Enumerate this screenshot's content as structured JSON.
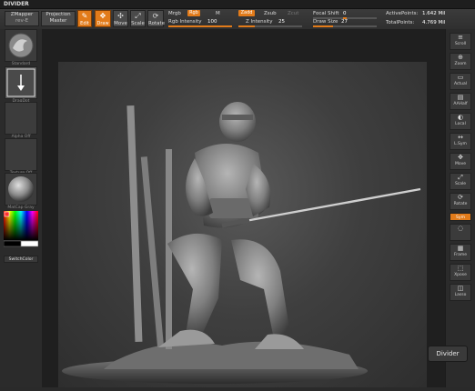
{
  "window": {
    "title": "DIVIDER"
  },
  "topbar": {
    "zmapper_label": "ZMapper",
    "zmapper_sub": "rev-E",
    "projection_label": "Projection",
    "projection_sub": "Master",
    "edit_label": "Edit",
    "draw_label": "Draw",
    "move_label": "Move",
    "scale_label": "Scale",
    "rotate_label": "Rotate",
    "mrgb_label": "Mrgb",
    "rgb_label": "Rgb",
    "m_label": "M",
    "rgb_intensity_label": "Rgb Intensity",
    "rgb_intensity_value": "100",
    "zadd_label": "Zadd",
    "zsub_label": "Zsub",
    "zcut_label": "Zcut",
    "z_intensity_label": "Z Intensity",
    "z_intensity_value": "25",
    "focal_shift_label": "Focal Shift",
    "focal_shift_value": "0",
    "draw_size_label": "Draw Size",
    "draw_size_value": "27",
    "active_points_label": "ActivePoints:",
    "active_points_value": "1.642 Mil",
    "total_points_label": "TotalPoints:",
    "total_points_value": "4.769 Mil"
  },
  "left_panel": {
    "slot1_label": "Standard",
    "slot2_label": "DragDot",
    "slot3_label": "Alpha Off",
    "slot4_label": "Texture Off",
    "slot5_label": "MatCap Gray",
    "switch_color_label": "SwitchColor"
  },
  "right_panel": {
    "buttons": [
      {
        "icon": "≡",
        "label": "Scroll"
      },
      {
        "icon": "⊕",
        "label": "Zoom"
      },
      {
        "icon": "▭",
        "label": "Actual"
      },
      {
        "icon": "▤",
        "label": "AAHalf"
      },
      {
        "icon": "◐",
        "label": "Local"
      },
      {
        "icon": "↔",
        "label": "L.Sym"
      },
      {
        "icon": "✥",
        "label": "Move"
      },
      {
        "icon": "⤢",
        "label": "Scale"
      },
      {
        "icon": "⟳",
        "label": "Rotate"
      },
      {
        "icon": "",
        "label": "Sym"
      },
      {
        "icon": "◌",
        "label": ""
      },
      {
        "icon": "▦",
        "label": "Frame"
      },
      {
        "icon": "⬚",
        "label": "Xpose"
      },
      {
        "icon": "◫",
        "label": "Lasso"
      }
    ]
  },
  "tooltip": {
    "text": "Divider"
  },
  "colors": {
    "accent": "#e27b1a",
    "panel": "#2b2b2b",
    "canvas": "#3f3f3f"
  },
  "canvas": {
    "subject": "ninja-sculpt"
  }
}
